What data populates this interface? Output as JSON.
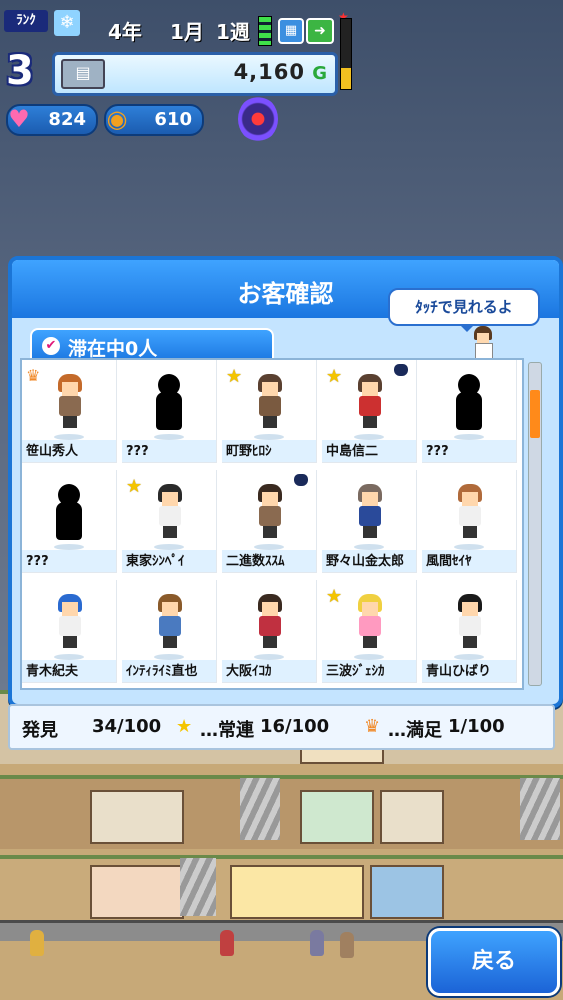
{
  "hud": {
    "rank_label": "ﾗﾝｸ",
    "rank_number": "3",
    "year": "4年",
    "month": "1月",
    "week": "1週",
    "money_value": "4,160",
    "money_unit": "G",
    "hearts": "824",
    "coins": "610",
    "gauge_level": 0.3,
    "icons": {
      "rank": "snowflake-icon",
      "speed": "speed-bars-icon",
      "calendar": "calendar-icon",
      "next": "next-arrow-icon",
      "money": "cash-icon",
      "heart": "heart-icon",
      "coin": "coin-icon",
      "lamp": "alarm-lamp-icon"
    }
  },
  "dialog": {
    "title": "お客確認",
    "tooltip": "ﾀｯﾁで見れるよ",
    "tab_label": "滞在中0人",
    "scroll_position": 0.1
  },
  "customers": [
    {
      "name": "笹山秀人",
      "badge": "crown",
      "known": true,
      "hair": "#c46a2a",
      "shirt": "#8a6a50"
    },
    {
      "name": "???",
      "badge": "",
      "known": false,
      "hair": "#000",
      "shirt": "#000"
    },
    {
      "name": "町野ﾋﾛｼ",
      "badge": "star",
      "known": true,
      "hair": "#5a4030",
      "shirt": "#7a5a40"
    },
    {
      "name": "中島信二",
      "badge": "star",
      "known": true,
      "hair": "#5a4030",
      "shirt": "#cc3030",
      "cat": true
    },
    {
      "name": "???",
      "badge": "",
      "known": false,
      "hair": "#000",
      "shirt": "#000"
    },
    {
      "name": "???",
      "badge": "",
      "known": false,
      "hair": "#000",
      "shirt": "#000"
    },
    {
      "name": "東家ｼﾝﾍﾟｲ",
      "badge": "star",
      "known": true,
      "hair": "#2a2a2a",
      "shirt": "#f0f0f0"
    },
    {
      "name": "二進数ｽｽﾑ",
      "badge": "",
      "known": true,
      "hair": "#3a2a20",
      "shirt": "#8a6a50",
      "cat": true
    },
    {
      "name": "野々山金太郎",
      "badge": "",
      "known": true,
      "hair": "#7a6a60",
      "shirt": "#2a4a9a"
    },
    {
      "name": "風間ｾｲﾔ",
      "badge": "",
      "known": true,
      "hair": "#b06a3a",
      "shirt": "#f0f0f0"
    },
    {
      "name": "青木紀夫",
      "badge": "",
      "known": true,
      "hair": "#2a6ad0",
      "shirt": "#f0f0f0"
    },
    {
      "name": "ｲﾝﾃｨﾗｲﾐ直也",
      "badge": "",
      "known": true,
      "hair": "#8a5a2a",
      "shirt": "#4a7ac0"
    },
    {
      "name": "大阪ｲｺｶ",
      "badge": "",
      "known": true,
      "hair": "#3a2a20",
      "shirt": "#c03040"
    },
    {
      "name": "三波ｼﾞｪｼｶ",
      "badge": "star",
      "known": true,
      "hair": "#f0d040",
      "shirt": "#ff9ac0"
    },
    {
      "name": "青山ひばり",
      "badge": "",
      "known": true,
      "hair": "#1a1a1a",
      "shirt": "#f0f0f0"
    }
  ],
  "stats": {
    "found_label": "発見",
    "found_value": "34/100",
    "regular_label": "…常連",
    "regular_value": "16/100",
    "satisfied_label": "…満足",
    "satisfied_value": "1/100",
    "star_symbol": "★",
    "crown_symbol": "♛"
  },
  "back_button": "戻る",
  "colors": {
    "accent": "#1b76e0",
    "panel": "#c4e4ff",
    "star": "#f4c400",
    "scroll_thumb": "#ff8a1a"
  }
}
